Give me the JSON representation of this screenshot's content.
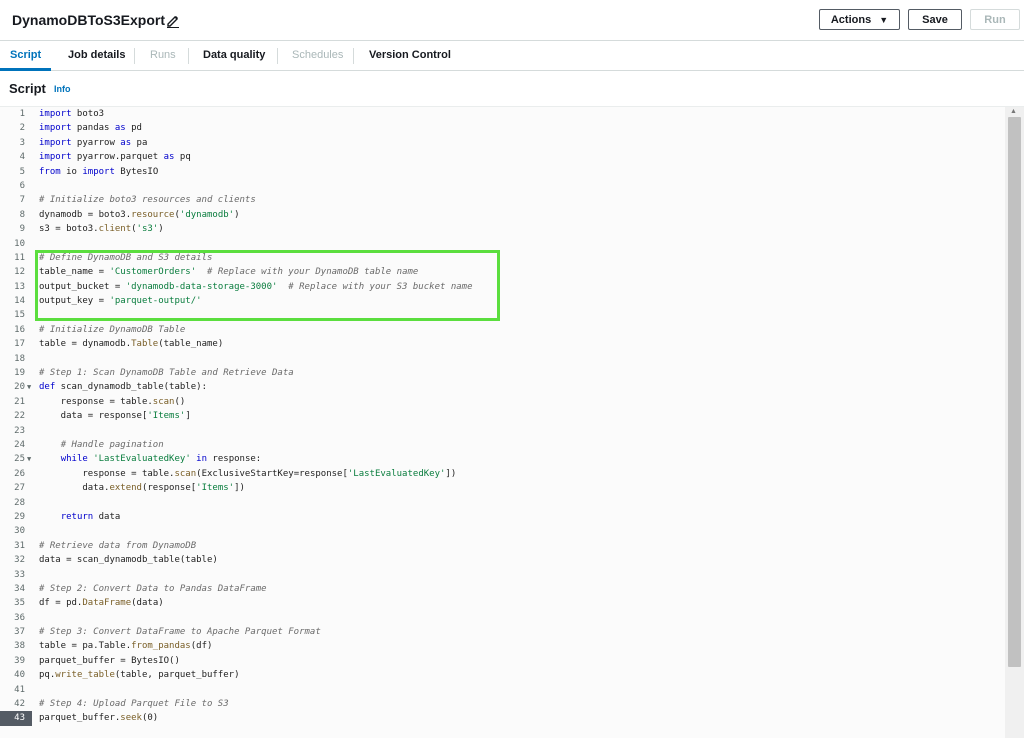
{
  "header": {
    "job_title": "DynamoDBToS3Export",
    "actions_label": "Actions",
    "save_label": "Save",
    "run_label": "Run"
  },
  "tabs": [
    {
      "label": "Script",
      "state": "active"
    },
    {
      "label": "Job details",
      "state": "enabled"
    },
    {
      "label": "Runs",
      "state": "disabled"
    },
    {
      "label": "Data quality",
      "state": "enabled"
    },
    {
      "label": "Schedules",
      "state": "disabled"
    },
    {
      "label": "Version Control",
      "state": "enabled"
    }
  ],
  "section": {
    "title": "Script",
    "info_link": "Info"
  },
  "editor": {
    "current_line": 43,
    "highlight_color": "#5bde3e",
    "lines": [
      "import boto3",
      "import pandas as pd",
      "import pyarrow as pa",
      "import pyarrow.parquet as pq",
      "from io import BytesIO",
      "",
      "# Initialize boto3 resources and clients",
      "dynamodb = boto3.resource('dynamodb')",
      "s3 = boto3.client('s3')",
      "",
      "# Define DynamoDB and S3 details",
      "table_name = 'CustomerOrders'  # Replace with your DynamoDB table name",
      "output_bucket = 'dynamodb-data-storage-3000'  # Replace with your S3 bucket name",
      "output_key = 'parquet-output/'",
      "",
      "# Initialize DynamoDB Table",
      "table = dynamodb.Table(table_name)",
      "",
      "# Step 1: Scan DynamoDB Table and Retrieve Data",
      "def scan_dynamodb_table(table):",
      "    response = table.scan()",
      "    data = response['Items']",
      "",
      "    # Handle pagination",
      "    while 'LastEvaluatedKey' in response:",
      "        response = table.scan(ExclusiveStartKey=response['LastEvaluatedKey'])",
      "        data.extend(response['Items'])",
      "",
      "    return data",
      "",
      "# Retrieve data from DynamoDB",
      "data = scan_dynamodb_table(table)",
      "",
      "# Step 2: Convert Data to Pandas DataFrame",
      "df = pd.DataFrame(data)",
      "",
      "# Step 3: Convert DataFrame to Apache Parquet Format",
      "table = pa.Table.from_pandas(df)",
      "parquet_buffer = BytesIO()",
      "pq.write_table(table, parquet_buffer)",
      "",
      "# Step 4: Upload Parquet File to S3",
      "parquet_buffer.seek(0)"
    ],
    "fold_lines": [
      20,
      25
    ]
  }
}
